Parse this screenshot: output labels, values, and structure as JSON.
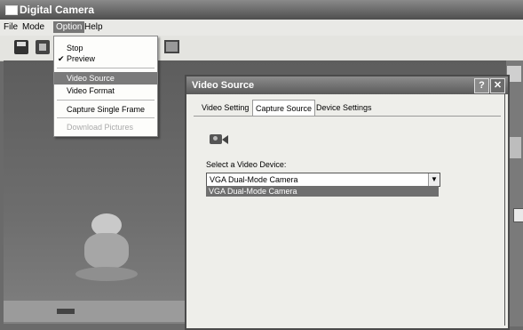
{
  "window": {
    "title": "Digital Camera"
  },
  "menubar": {
    "items": [
      "File",
      "Mode",
      "Option",
      "Help"
    ]
  },
  "option_menu": {
    "items": [
      {
        "label": "Stop",
        "checked": false,
        "disabled": false
      },
      {
        "label": "Preview",
        "checked": true,
        "disabled": false
      },
      {
        "label": "Video Source",
        "checked": false,
        "disabled": false,
        "highlighted": true
      },
      {
        "label": "Video Format",
        "checked": false,
        "disabled": false
      },
      {
        "label": "Capture Single Frame",
        "checked": false,
        "disabled": false
      },
      {
        "label": "Download Pictures",
        "checked": false,
        "disabled": true
      }
    ],
    "check_glyph": "✔"
  },
  "toolbar": {
    "icons": [
      "save-icon",
      "save-all-icon",
      "monitor-icon"
    ]
  },
  "dialog": {
    "title": "Video Source",
    "help_glyph": "?",
    "close_glyph": "✕",
    "tabs": [
      "Video Setting",
      "Capture Source",
      "Device Settings"
    ],
    "active_tab": "Capture Source",
    "device_label": "Select a Video Device:",
    "device_value": "VGA Dual-Mode Camera",
    "device_option": "VGA Dual-Mode Camera",
    "arrow_glyph": "▼"
  }
}
